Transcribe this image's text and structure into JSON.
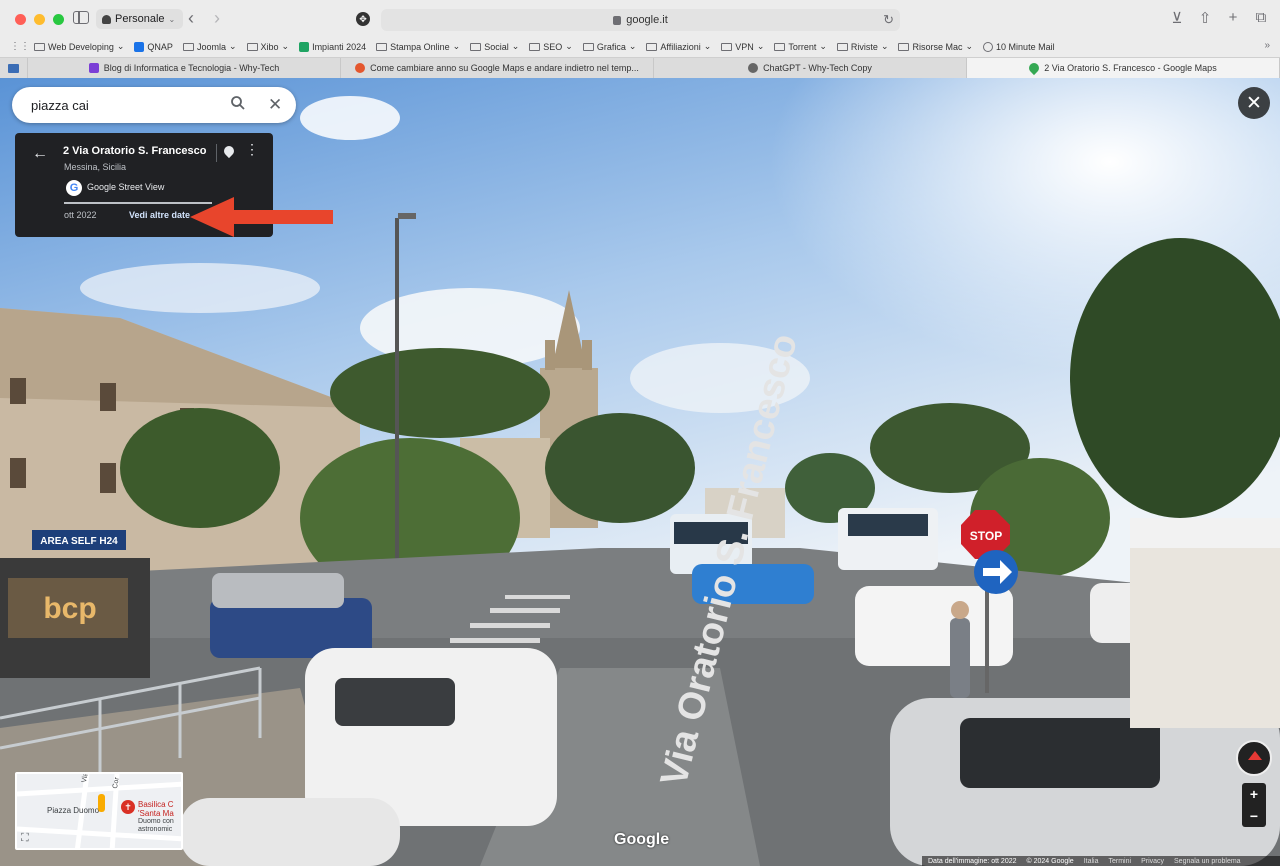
{
  "browser": {
    "profile": "Personale",
    "url": "google.it",
    "bookmarks": [
      {
        "label": "Web Developing",
        "icon": "folder-icon"
      },
      {
        "label": "QNAP",
        "icon": "qnap-icon"
      },
      {
        "label": "Joomla",
        "icon": "folder-icon"
      },
      {
        "label": "Xibo",
        "icon": "folder-icon"
      },
      {
        "label": "Impianti 2024",
        "icon": "sheet-icon"
      },
      {
        "label": "Stampa Online",
        "icon": "folder-icon"
      },
      {
        "label": "Social",
        "icon": "folder-icon"
      },
      {
        "label": "SEO",
        "icon": "folder-icon"
      },
      {
        "label": "Grafica",
        "icon": "folder-icon"
      },
      {
        "label": "Affiliazioni",
        "icon": "folder-icon"
      },
      {
        "label": "VPN",
        "icon": "folder-icon"
      },
      {
        "label": "Torrent",
        "icon": "folder-icon"
      },
      {
        "label": "Riviste",
        "icon": "folder-icon"
      },
      {
        "label": "Risorse Mac",
        "icon": "folder-icon"
      },
      {
        "label": "10 Minute Mail",
        "icon": "globe-icon"
      }
    ],
    "tabs": [
      {
        "label": "Blog di Informatica e Tecnologia - Why-Tech",
        "active": false
      },
      {
        "label": "Come cambiare anno su Google Maps e andare indietro nel temp...",
        "active": false
      },
      {
        "label": "ChatGPT - Why-Tech Copy",
        "active": false
      },
      {
        "label": "2 Via Oratorio S. Francesco - Google Maps",
        "active": true
      }
    ]
  },
  "maps": {
    "search": {
      "value": "piazza cai"
    },
    "info": {
      "title": "2 Via Oratorio S. Francesco",
      "subtitle": "Messina, Sicilia",
      "source": "Google Street View",
      "date": "ott 2022",
      "more_dates": "Vedi altre date"
    },
    "minimap": {
      "labels": [
        "Piazza Duomo",
        "Basilica C",
        "'Santa Ma",
        "Duomo con",
        "astronomic",
        "Via XX",
        "Cor"
      ]
    },
    "street_sign": "STOP",
    "shop_sign": "AREA SELF H24",
    "bank_sign": "bcp",
    "road_marking": "Via Oratorio S. Francesco",
    "watermark": "Google",
    "footer": {
      "image_date": "Data dell'immagine: ott 2022",
      "copyright": "© 2024 Google",
      "links": [
        "Italia",
        "Termini",
        "Privacy",
        "Segnala un problema"
      ]
    },
    "colors": {
      "arrow": "#e8452c",
      "panel": "#202124",
      "sky": "#7fb0e0"
    }
  }
}
